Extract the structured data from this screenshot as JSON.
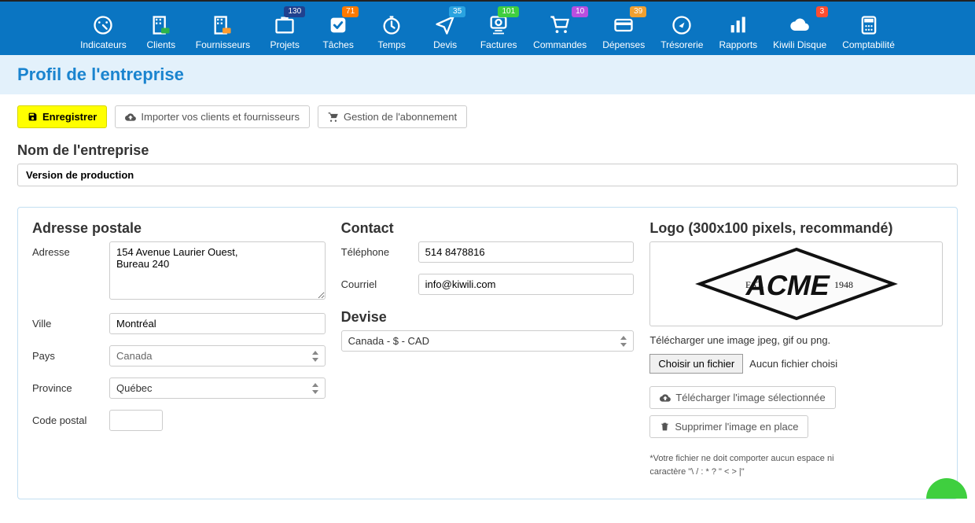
{
  "nav": [
    {
      "label": "Indicateurs",
      "badge": null,
      "icon": "gauge"
    },
    {
      "label": "Clients",
      "badge": null,
      "icon": "clients"
    },
    {
      "label": "Fournisseurs",
      "badge": null,
      "icon": "suppliers"
    },
    {
      "label": "Projets",
      "badge": "130",
      "badge_color": "#20418f",
      "icon": "projects"
    },
    {
      "label": "Tâches",
      "badge": "71",
      "badge_color": "#ff7a00",
      "icon": "tasks"
    },
    {
      "label": "Temps",
      "badge": null,
      "icon": "time"
    },
    {
      "label": "Devis",
      "badge": "35",
      "badge_color": "#2aa3e0",
      "icon": "quote"
    },
    {
      "label": "Factures",
      "badge": "101",
      "badge_color": "#3fcf3f",
      "icon": "invoice"
    },
    {
      "label": "Commandes",
      "badge": "10",
      "badge_color": "#b84fe0",
      "icon": "cart"
    },
    {
      "label": "Dépenses",
      "badge": "39",
      "badge_color": "#f0a030",
      "icon": "card"
    },
    {
      "label": "Trésorerie",
      "badge": null,
      "icon": "compass"
    },
    {
      "label": "Rapports",
      "badge": null,
      "icon": "bars"
    },
    {
      "label": "Kiwili Disque",
      "badge": "3",
      "badge_color": "#ff4d30",
      "icon": "cloud"
    },
    {
      "label": "Comptabilité",
      "badge": null,
      "icon": "calc"
    }
  ],
  "page_title": "Profil de l'entreprise",
  "buttons": {
    "save": "Enregistrer",
    "import": "Importer vos clients et fournisseurs",
    "subscription": "Gestion de l'abonnement"
  },
  "company_name_label": "Nom de l'entreprise",
  "company_name_value": "Version de production",
  "address": {
    "title": "Adresse postale",
    "address_label": "Adresse",
    "address_value": "154 Avenue Laurier Ouest,\nBureau 240",
    "city_label": "Ville",
    "city_value": "Montréal",
    "country_label": "Pays",
    "country_value": "Canada",
    "province_label": "Province",
    "province_value": "Québec",
    "postal_label": "Code postal",
    "postal_value": ""
  },
  "contact": {
    "title": "Contact",
    "phone_label": "Téléphone",
    "phone_value": "514 8478816",
    "email_label": "Courriel",
    "email_value": "info@kiwili.com"
  },
  "currency": {
    "title": "Devise",
    "value": "Canada - $ - CAD"
  },
  "logo": {
    "title": "Logo (300x100 pixels, recommandé)",
    "est_text": "EST.",
    "year_text": "1948",
    "brand_text": "ACME",
    "hint": "Télécharger une image jpeg, gif ou png.",
    "choose_file": "Choisir un fichier",
    "no_file": "Aucun fichier choisi",
    "upload_selected": "Télécharger l'image sélectionnée",
    "delete_image": "Supprimer l'image en place",
    "footnote": "*Votre fichier ne doit comporter aucun espace ni caractère \"\\ / : * ? \" < > |\""
  }
}
